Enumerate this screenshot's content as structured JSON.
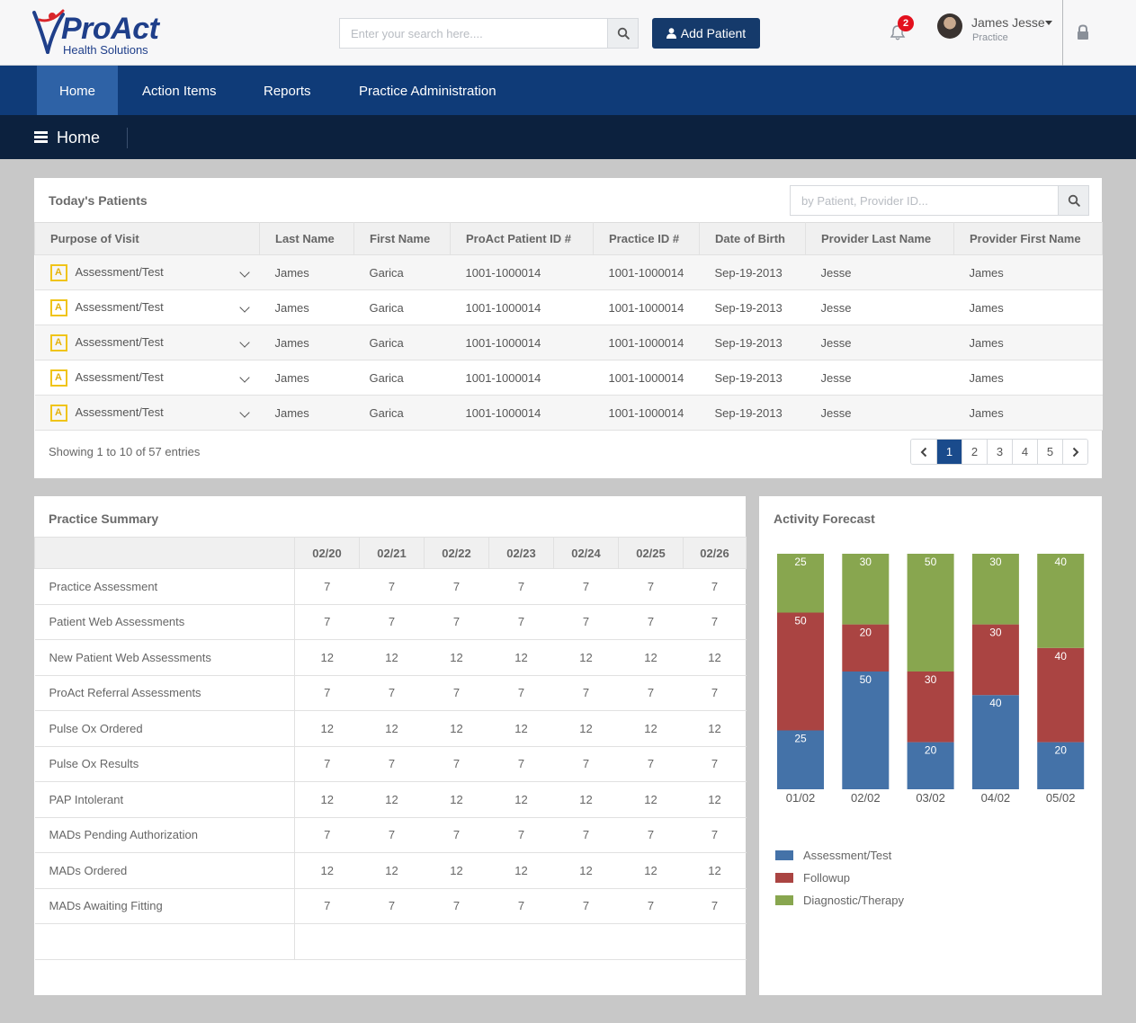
{
  "header": {
    "brand_name": "ProAct",
    "brand_sub": "Health Solutions",
    "search_placeholder": "Enter your search here....",
    "add_patient_label": "Add Patient",
    "notification_count": "2",
    "user_name": "James Jesse",
    "user_role": "Practice",
    "icons": [
      "search-icon",
      "user-icon",
      "bell-icon",
      "lock-icon"
    ]
  },
  "nav": {
    "items": [
      {
        "label": "Home",
        "active": true
      },
      {
        "label": "Action Items",
        "active": false
      },
      {
        "label": "Reports",
        "active": false
      },
      {
        "label": "Practice Administration",
        "active": false
      }
    ]
  },
  "subheader": {
    "title": "Home"
  },
  "todays_patients": {
    "title": "Today's Patients",
    "search_placeholder": "by Patient, Provider ID...",
    "columns": [
      "Purpose of Visit",
      "Last Name",
      "First Name",
      "ProAct Patient ID #",
      "Practice ID #",
      "Date of Birth",
      "Provider Last Name",
      "Provider First Name"
    ],
    "rows": [
      {
        "badge": "A",
        "purpose": "Assessment/Test",
        "last": "James",
        "first": "Garica",
        "proact_id": "1001-1000014",
        "practice_id": "1001-1000014",
        "dob": "Sep-19-2013",
        "prov_last": "Jesse",
        "prov_first": "James"
      },
      {
        "badge": "A",
        "purpose": "Assessment/Test",
        "last": "James",
        "first": "Garica",
        "proact_id": "1001-1000014",
        "practice_id": "1001-1000014",
        "dob": "Sep-19-2013",
        "prov_last": "Jesse",
        "prov_first": "James"
      },
      {
        "badge": "A",
        "purpose": "Assessment/Test",
        "last": "James",
        "first": "Garica",
        "proact_id": "1001-1000014",
        "practice_id": "1001-1000014",
        "dob": "Sep-19-2013",
        "prov_last": "Jesse",
        "prov_first": "James"
      },
      {
        "badge": "A",
        "purpose": "Assessment/Test",
        "last": "James",
        "first": "Garica",
        "proact_id": "1001-1000014",
        "practice_id": "1001-1000014",
        "dob": "Sep-19-2013",
        "prov_last": "Jesse",
        "prov_first": "James"
      },
      {
        "badge": "A",
        "purpose": "Assessment/Test",
        "last": "James",
        "first": "Garica",
        "proact_id": "1001-1000014",
        "practice_id": "1001-1000014",
        "dob": "Sep-19-2013",
        "prov_last": "Jesse",
        "prov_first": "James"
      }
    ],
    "showing_text": "Showing 1 to 10 of 57 entries",
    "pages": [
      "1",
      "2",
      "3",
      "4",
      "5"
    ],
    "current_page": "1"
  },
  "practice_summary": {
    "title": "Practice Summary",
    "dates": [
      "02/20",
      "02/21",
      "02/22",
      "02/23",
      "02/24",
      "02/25",
      "02/26"
    ],
    "rows": [
      {
        "label": "Practice Assessment",
        "values": [
          "7",
          "7",
          "7",
          "7",
          "7",
          "7",
          "7"
        ]
      },
      {
        "label": "Patient Web Assessments",
        "values": [
          "7",
          "7",
          "7",
          "7",
          "7",
          "7",
          "7"
        ]
      },
      {
        "label": "New Patient Web Assessments",
        "values": [
          "12",
          "12",
          "12",
          "12",
          "12",
          "12",
          "12"
        ]
      },
      {
        "label": "ProAct Referral Assessments",
        "values": [
          "7",
          "7",
          "7",
          "7",
          "7",
          "7",
          "7"
        ]
      },
      {
        "label": "Pulse Ox Ordered",
        "values": [
          "12",
          "12",
          "12",
          "12",
          "12",
          "12",
          "12"
        ]
      },
      {
        "label": "Pulse Ox Results",
        "values": [
          "7",
          "7",
          "7",
          "7",
          "7",
          "7",
          "7"
        ]
      },
      {
        "label": "PAP Intolerant",
        "values": [
          "12",
          "12",
          "12",
          "12",
          "12",
          "12",
          "12"
        ]
      },
      {
        "label": "MADs Pending Authorization",
        "values": [
          "7",
          "7",
          "7",
          "7",
          "7",
          "7",
          "7"
        ]
      },
      {
        "label": "MADs Ordered",
        "values": [
          "12",
          "12",
          "12",
          "12",
          "12",
          "12",
          "12"
        ]
      },
      {
        "label": "MADs Awaiting Fitting",
        "values": [
          "7",
          "7",
          "7",
          "7",
          "7",
          "7",
          "7"
        ]
      }
    ]
  },
  "activity_forecast": {
    "title": "Activity Forecast"
  },
  "chart_data": {
    "type": "bar",
    "stacked": true,
    "categories": [
      "01/02",
      "02/02",
      "03/02",
      "04/02",
      "05/02"
    ],
    "series": [
      {
        "name": "Assessment/Test",
        "color": "#4472a8",
        "values": [
          25,
          50,
          20,
          40,
          20
        ]
      },
      {
        "name": "Followup",
        "color": "#aa4442",
        "values": [
          50,
          20,
          30,
          30,
          40
        ]
      },
      {
        "name": "Diagnostic/Therapy",
        "color": "#88a64f",
        "values": [
          25,
          30,
          50,
          30,
          40
        ]
      }
    ],
    "ylim": [
      0,
      100
    ],
    "legend": "bottom-left",
    "grid": false
  }
}
